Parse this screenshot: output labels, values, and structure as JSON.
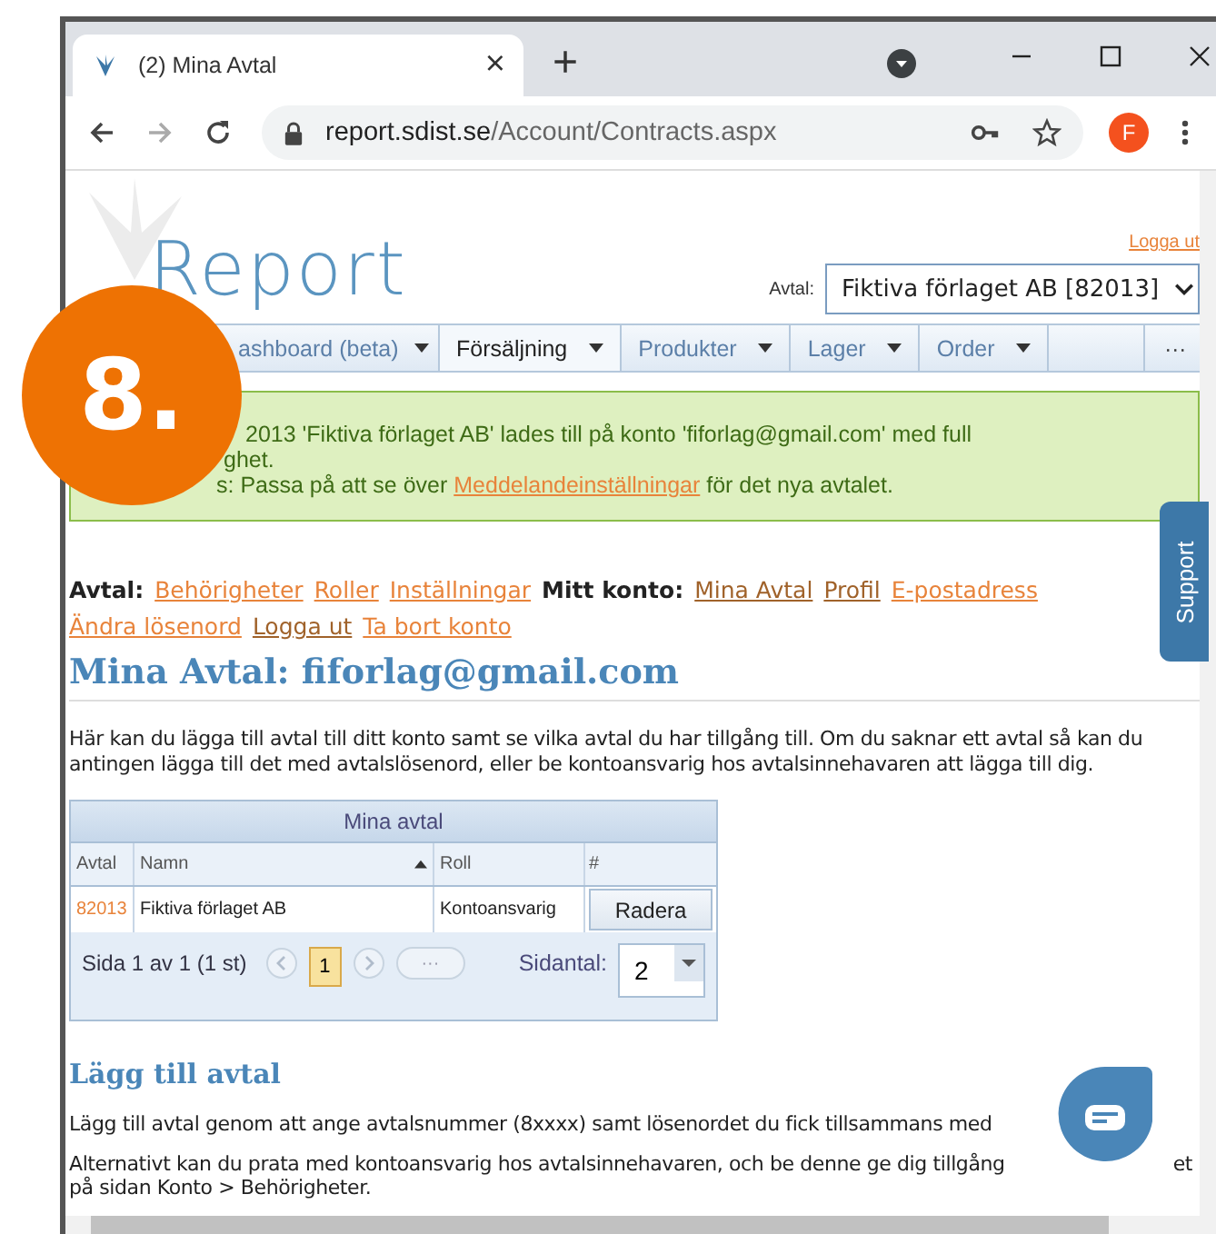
{
  "browser": {
    "tab_title": "(2) Mina Avtal",
    "tab_close": "×",
    "new_tab": "+",
    "url_host": "report.sdist.se",
    "url_path": "/Account/Contracts.aspx",
    "profile_initial": "F"
  },
  "header": {
    "logo_text": "Report",
    "logout": "Logga ut",
    "contract_label": "Avtal:",
    "contract_select": "Fiktiva förlaget AB [82013]"
  },
  "nav": [
    {
      "kind": "menu",
      "label": "ashboard (beta)",
      "selected": false
    },
    {
      "kind": "menu",
      "label": "Försäljning",
      "selected": true
    },
    {
      "kind": "menu",
      "label": "Produkter",
      "selected": false
    },
    {
      "kind": "menu",
      "label": "Lager",
      "selected": false
    },
    {
      "kind": "menu",
      "label": "Order",
      "selected": false
    },
    {
      "kind": "blank"
    },
    {
      "kind": "more",
      "label": "···"
    }
  ],
  "notice": {
    "lines": [
      "2013 'Fiktiva förlaget AB' lades till på konto 'fiforlag@gmail.com' med full",
      "ghet."
    ],
    "tip_prefix": "s: Passa på att se över ",
    "tip_link": "Meddelandeinställningar",
    "tip_suffix": " för det nya avtalet."
  },
  "support_tab": "Support",
  "account_links": [
    {
      "kind": "label",
      "text": "Avtal:"
    },
    {
      "kind": "link",
      "text": "Behörigheter",
      "visited": false
    },
    {
      "kind": "link",
      "text": "Roller",
      "visited": false
    },
    {
      "kind": "link",
      "text": "Inställningar",
      "visited": false
    },
    {
      "kind": "label",
      "text": "Mitt konto:"
    },
    {
      "kind": "link",
      "text": "Mina Avtal",
      "visited": true
    },
    {
      "kind": "link",
      "text": "Profil",
      "visited": true
    },
    {
      "kind": "link",
      "text": "E-postadress",
      "visited": false
    },
    {
      "kind": "link",
      "text": "Ändra lösenord",
      "visited": false
    },
    {
      "kind": "link",
      "text": "Logga ut",
      "visited": true
    },
    {
      "kind": "link",
      "text": "Ta bort konto",
      "visited": false
    }
  ],
  "title": "Mina Avtal: fiforlag@gmail.com",
  "intro": "Här kan du lägga till avtal till ditt konto samt se vilka avtal du har tillgång till. Om du saknar ett avtal så kan du antingen lägga till det med avtalslösenord, eller be kontoansvarig hos avtalsinnehavaren att lägga till dig.",
  "grid": {
    "caption": "Mina avtal",
    "columns": [
      {
        "label": "Avtal",
        "sorted": false
      },
      {
        "label": "Namn",
        "sorted": true
      },
      {
        "label": "Roll",
        "sorted": false
      },
      {
        "label": "#",
        "sorted": false
      }
    ],
    "rows": [
      {
        "contract": "82013",
        "name": "Fiktiva förlaget AB",
        "role": "Kontoansvarig",
        "action": "Radera"
      }
    ],
    "pager": {
      "summary": "Sida 1 av 1 (1 st)",
      "pages": [
        {
          "label": "1",
          "selected": true
        }
      ],
      "ellipsis": "···",
      "page_size_label": "Sidantal:",
      "page_size": "2"
    }
  },
  "add_section": {
    "title": "Lägg till avtal",
    "line_1": "Lägg till avtal genom att ange avtalsnummer (8xxxx) samt lösenordet du fick tillsammans med",
    "line_2": "Alternativt kan du prata med kontoansvarig hos avtalsinnehavaren, och be denne ge dig tillgång",
    "line_2_end": "et",
    "line_3": "på sidan Konto > Behörigheter."
  },
  "step_badge": "8."
}
